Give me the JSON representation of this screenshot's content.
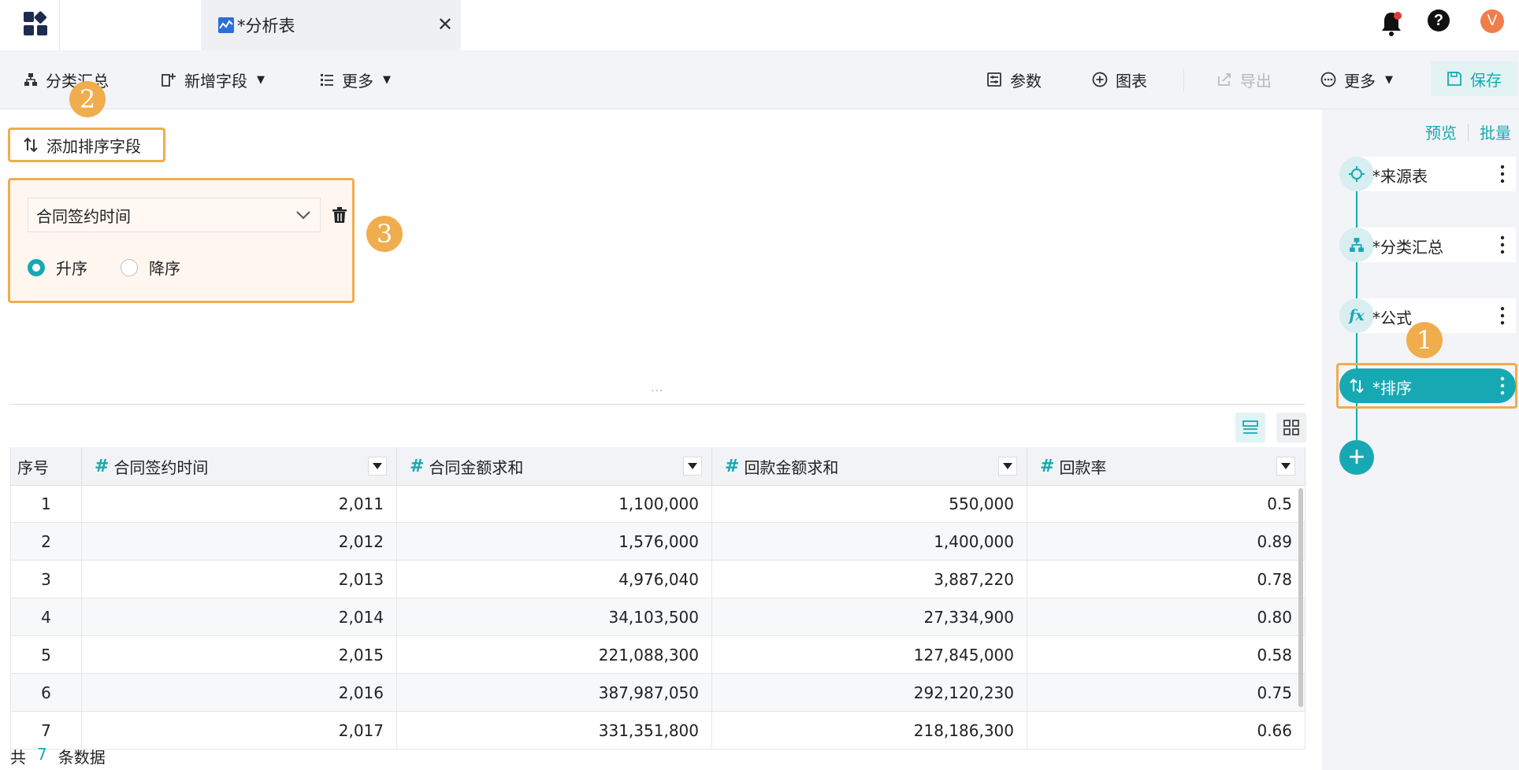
{
  "tabs": {
    "active_label": "*分析表"
  },
  "toolbar": {
    "summary_label": "分类汇总",
    "add_field_label": "新增字段",
    "more_left_label": "更多",
    "params_label": "参数",
    "chart_label": "图表",
    "export_label": "导出",
    "more_right_label": "更多",
    "save_label": "保存"
  },
  "user": {
    "avatar_letter": "V"
  },
  "sort": {
    "add_label": "添加排序字段",
    "field_value": "合同签约时间",
    "asc_label": "升序",
    "desc_label": "降序",
    "selected": "asc"
  },
  "badges": {
    "b1": "1",
    "b2": "2",
    "b3": "3"
  },
  "table": {
    "headers": [
      "序号",
      "合同签约时间",
      "合同金额求和",
      "回款金额求和",
      "回款率"
    ],
    "rows": [
      [
        "1",
        "2,011",
        "1,100,000",
        "550,000",
        "0.5"
      ],
      [
        "2",
        "2,012",
        "1,576,000",
        "1,400,000",
        "0.89"
      ],
      [
        "3",
        "2,013",
        "4,976,040",
        "3,887,220",
        "0.78"
      ],
      [
        "4",
        "2,014",
        "34,103,500",
        "27,334,900",
        "0.80"
      ],
      [
        "5",
        "2,015",
        "221,088,300",
        "127,845,000",
        "0.58"
      ],
      [
        "6",
        "2,016",
        "387,987,050",
        "292,120,230",
        "0.75"
      ],
      [
        "7",
        "2,017",
        "331,351,800",
        "218,186,300",
        "0.66"
      ]
    ]
  },
  "footer": {
    "prefix": "共",
    "count": "7",
    "suffix": "条数据"
  },
  "panel": {
    "preview_label": "预览",
    "batch_label": "批量",
    "nodes": [
      {
        "label": "*来源表",
        "icon": "crosshair-icon"
      },
      {
        "label": "*分类汇总",
        "icon": "hierarchy-icon"
      },
      {
        "label": "*公式",
        "icon": "fx-icon"
      },
      {
        "label": "*排序",
        "icon": "sort-icon",
        "active": true
      }
    ]
  },
  "colors": {
    "accent": "#17a9b3",
    "highlight": "#f0ad4e",
    "avatar": "#ef7f4a"
  }
}
